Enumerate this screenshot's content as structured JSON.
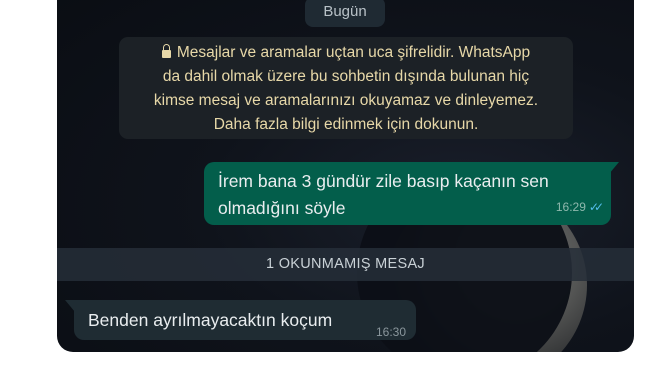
{
  "chat": {
    "date_chip": "Bugün",
    "encryption_notice": {
      "lines": [
        "Mesajlar ve aramalar uçtan uca şifrelidir. WhatsApp",
        "da dahil olmak üzere bu sohbetin dışında bulunan hiç",
        "kimse mesaj ve aramalarınızı okuyamaz ve dinleyemez.",
        "Daha fazla bilgi edinmek için dokunun."
      ],
      "icon": "lock-icon"
    },
    "outgoing_message": {
      "lines": [
        "İrem bana 3 gündür zile basıp kaçanın sen",
        "olmadığını söyle"
      ],
      "time": "16:29",
      "status_icon": "double-check-icon",
      "status_color": "#53bdeb"
    },
    "unread_divider": "1 OKUNMAMIŞ MESAJ",
    "incoming_message": {
      "text": "Benden ayrılmayacaktın koçum",
      "time": "16:30"
    }
  },
  "colors": {
    "outgoing_bubble": "#035e4b",
    "incoming_bubble": "#1f2c33",
    "encryption_text": "#e7d8a8",
    "background": "#0f131b"
  }
}
